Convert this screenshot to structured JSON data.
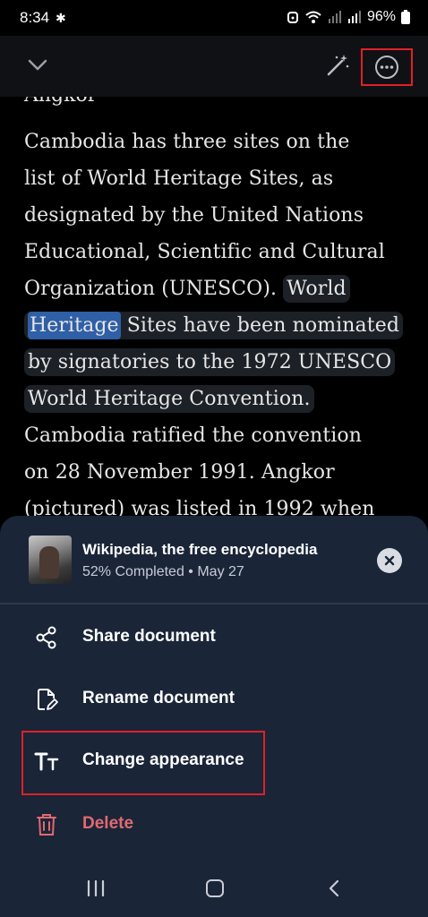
{
  "status_bar": {
    "time": "8:34",
    "battery": "96%"
  },
  "reader": {
    "partial_top": "Angkor",
    "lines": [
      "Cambodia has three sites on the",
      "list of World Heritage Sites, as",
      "designated by the United Nations",
      "Educational, Scientific and Cultural",
      "Organization (UNESCO).",
      "World",
      "Heritage",
      "Sites have been nominated",
      "by signatories to the 1972 UNESCO",
      "World Heritage Convention.",
      "Cambodia ratified the convention",
      "on 28 November 1991. Angkor",
      "(pictured) was listed in 1992 when"
    ]
  },
  "sheet": {
    "doc_title": "Wikipedia, the free encyclopedia",
    "doc_meta": "52% Completed • May 27",
    "menu": [
      {
        "label": "Share document",
        "icon": "share-icon"
      },
      {
        "label": "Rename document",
        "icon": "rename-file-icon"
      },
      {
        "label": "Change appearance",
        "icon": "text-size-icon"
      },
      {
        "label": "Delete",
        "icon": "trash-icon"
      }
    ]
  },
  "colors": {
    "sheet_bg": "#1a2537",
    "highlight_word": "#2f5fa6",
    "delete_red": "#e06a72",
    "annotation_red": "#e0202a"
  }
}
